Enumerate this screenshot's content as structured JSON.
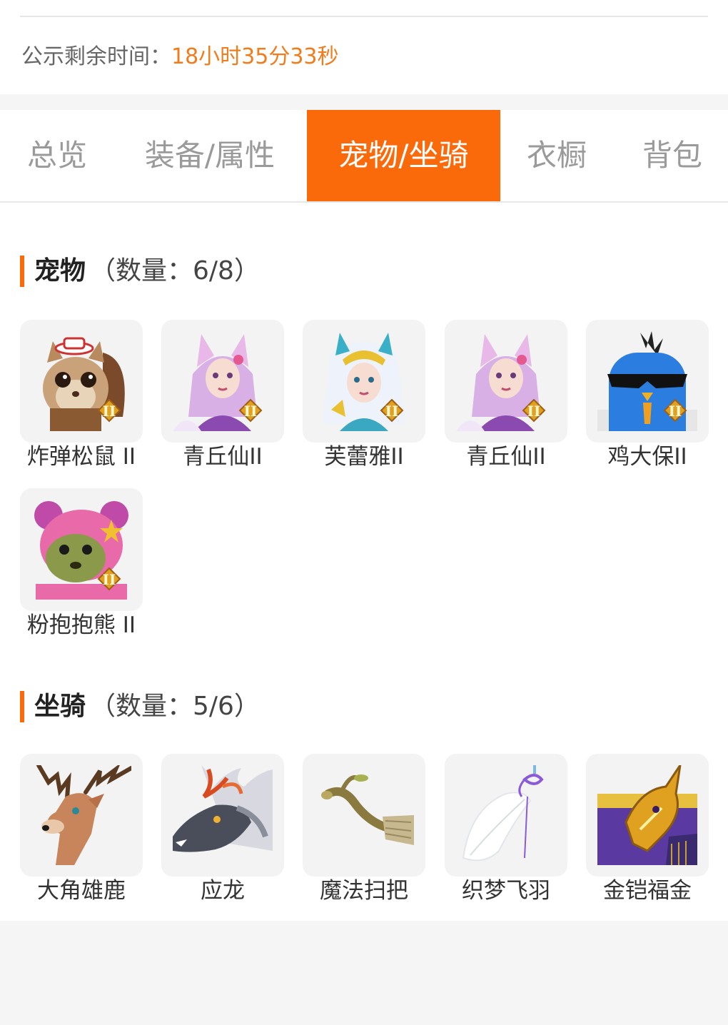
{
  "notice": {
    "label": "公示剩余时间：",
    "time": "18小时35分33秒"
  },
  "tabs": [
    {
      "label": "总览"
    },
    {
      "label": "装备/属性"
    },
    {
      "label": "宠物/坐骑"
    },
    {
      "label": "衣橱"
    },
    {
      "label": "背包"
    }
  ],
  "active_tab": "宠物/坐骑",
  "pets": {
    "title": "宠物",
    "count": "（数量：6/8）",
    "items": [
      {
        "name": "炸弹松鼠 II"
      },
      {
        "name": "青丘仙II"
      },
      {
        "name": "芙蕾雅II"
      },
      {
        "name": "青丘仙II"
      },
      {
        "name": "鸡大保II"
      },
      {
        "name": "粉抱抱熊 II"
      }
    ]
  },
  "mounts": {
    "title": "坐骑",
    "count": "（数量：5/6）",
    "items": [
      {
        "name": "大角雄鹿"
      },
      {
        "name": "应龙"
      },
      {
        "name": "魔法扫把"
      },
      {
        "name": "织梦飞羽"
      },
      {
        "name": "金铠福金"
      }
    ]
  },
  "colors": {
    "accent": "#fb6a0a",
    "time": "#f07c1c"
  }
}
